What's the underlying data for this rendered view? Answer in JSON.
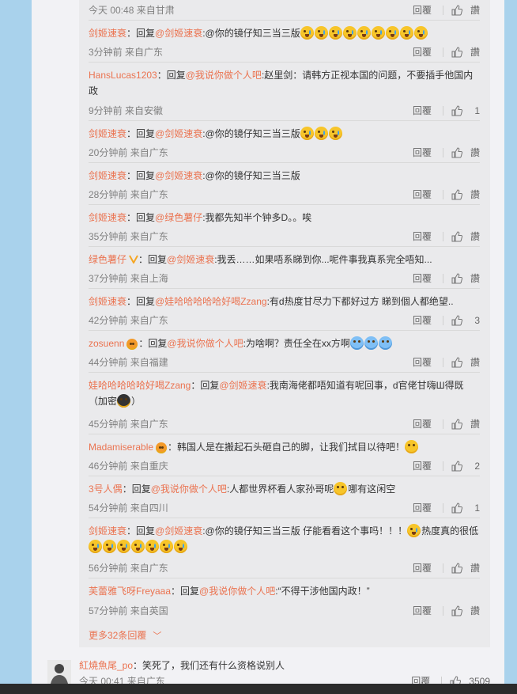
{
  "top_row": {
    "time": "今天 00:48",
    "source": "来自甘肃",
    "reply": "回覆",
    "likes": "讚"
  },
  "replies": [
    {
      "user": "剑姬速衰",
      "text_prefix": "：回复",
      "target": "@剑姬速衰",
      "text": ":@你的镜仔知三当三版",
      "emojis": 9,
      "time": "3分钟前",
      "source": "来自广东",
      "reply": "回覆",
      "likes": "讚"
    },
    {
      "user": "HansLucas1203",
      "text_prefix": "：回复",
      "target": "@我说你做个人吧",
      "text": ":赵里剑：请韩方正视本国的问题，不要插手他国内政",
      "time": "9分钟前",
      "source": "来自安徽",
      "reply": "回覆",
      "likes": "1"
    },
    {
      "user": "剑姬速衰",
      "text_prefix": "：回复",
      "target": "@剑姬速衰",
      "text": ":@你的镜仔知三当三版",
      "emojis": 3,
      "time": "20分钟前",
      "source": "来自广东",
      "reply": "回覆",
      "likes": "讚"
    },
    {
      "user": "剑姬速衰",
      "text_prefix": "：回复",
      "target": "@剑姬速衰",
      "text": ":@你的镜仔知三当三版",
      "time": "28分钟前",
      "source": "来自广东",
      "reply": "回覆",
      "likes": "讚"
    },
    {
      "user": "剑姬速衰",
      "text_prefix": "：回复",
      "target": "@绿色薯仔",
      "text": ":我都先知半个钟多D。。唉",
      "time": "35分钟前",
      "source": "来自广东",
      "reply": "回覆",
      "likes": "讚"
    },
    {
      "user": "绿色薯仔",
      "text_prefix": "：回复",
      "target": "@剑姬速衰",
      "text": ":我丢……如果唔系睇到你...呢件事我真系完全唔知...",
      "time": "37分钟前",
      "source": "来自上海",
      "reply": "回覆",
      "likes": "讚"
    },
    {
      "user": "剑姬速衰",
      "text_prefix": "：回复",
      "target": "@娃哈哈哈哈哈好喝Zzang",
      "text": ":有d热度甘尽力下都好过方 睇到個人都绝望..",
      "time": "42分钟前",
      "source": "来自广东",
      "reply": "回覆",
      "likes": "3"
    },
    {
      "user": "zosuenn",
      "text_prefix": "：回复",
      "target": "@我说你做个人吧",
      "text": ":为啥啊？责任全在xx方啊",
      "emojis": 3,
      "time": "44分钟前",
      "source": "来自福建",
      "reply": "回覆",
      "likes": "讚"
    },
    {
      "user": "娃哈哈哈哈哈好喝Zzang",
      "text_prefix": "：回复",
      "target": "@剑姬速衰",
      "text": ":我南海佬都唔知道有呢回事，d官佬甘嗨Ш得既（加密",
      "text_tail": "）",
      "time": "45分钟前",
      "source": "来自广东",
      "reply": "回覆",
      "likes": "讚"
    },
    {
      "user": "Madamiserable",
      "text_prefix": "",
      "target": "",
      "text": "：韩国人是在搬起石头砸自己的脚，让我们拭目以待吧！",
      "time": "46分钟前",
      "source": "来自重庆",
      "reply": "回覆",
      "likes": "2"
    },
    {
      "user": "3号人偶",
      "text_prefix": "：回复",
      "target": "@我说你做个人吧",
      "text": ":人都世界杯看人家孙哥呢",
      "text_tail": "哪有这闲空",
      "time": "54分钟前",
      "source": "来自四川",
      "reply": "回覆",
      "likes": "1"
    },
    {
      "user": "剑姬速衰",
      "text_prefix": "：回复",
      "target": "@剑姬速衰",
      "text": ":@你的镜仔知三当三版 仔能看看这个事吗！！！",
      "text_tail": "热度真的很低",
      "emojis": 7,
      "time": "56分钟前",
      "source": "来自广东",
      "reply": "回覆",
      "likes": "讚"
    },
    {
      "user": "芙蕾雅飞呀Freyaaa",
      "text_prefix": "：回复",
      "target": "@我说你做个人吧",
      "text": ":“不得干涉他国内政！”",
      "time": "57分钟前",
      "source": "来自英国",
      "reply": "回覆",
      "likes": "讚"
    }
  ],
  "more_replies": "更多32条回覆",
  "main_comment": {
    "user": "紅燒魚尾_po",
    "text": "：笑死了，我们还有什么资格说别人",
    "time": "今天 00:41",
    "source": "来自广东",
    "reply": "回覆",
    "likes": "3509"
  },
  "colors": {
    "accent": "#eb7350",
    "background": "#a9d2ec",
    "thread_bg": "#eaeaec"
  }
}
